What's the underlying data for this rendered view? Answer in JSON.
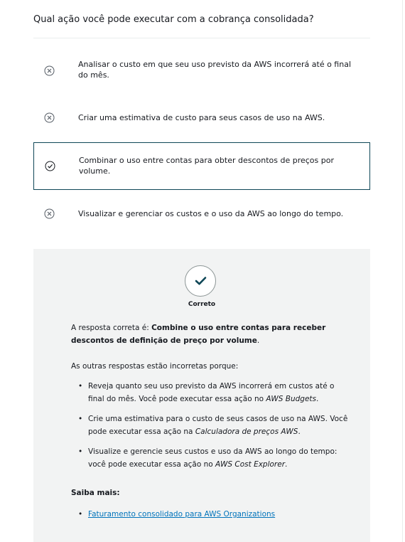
{
  "question": "Qual ação você pode executar com a cobrança consolidada?",
  "options": [
    {
      "text": "Analisar o custo em que seu uso previsto da AWS incorrerá até o final do mês.",
      "state": "incorrect"
    },
    {
      "text": "Criar uma estimativa de custo para seus casos de uso na AWS.",
      "state": "incorrect"
    },
    {
      "text": "Combinar o uso entre contas para obter descontos de preços por volume.",
      "state": "correct"
    },
    {
      "text": "Visualizar e gerenciar os custos e o uso da AWS ao longo do tempo.",
      "state": "incorrect"
    }
  ],
  "feedback": {
    "result_label": "Correto",
    "correct_prefix": "A resposta correta é: ",
    "correct_answer": "Combine o uso entre contas para receber descontos de definição de preço por volume",
    "correct_suffix": ".",
    "others_intro": "As outras respostas estão incorretas porque:",
    "reasons": [
      {
        "text": "Reveja quanto seu uso previsto da AWS incorrerá em custos até o final do mês. Você pode executar essa ação no ",
        "tool": "AWS Budgets",
        "end": "."
      },
      {
        "text": "Crie uma estimativa para o custo de seus casos de uso na AWS. Você pode executar essa ação na ",
        "tool": "Calculadora de preços AWS",
        "end": "."
      },
      {
        "text": "Visualize e gerencie seus custos e uso da AWS ao longo do tempo: você pode executar essa ação no ",
        "tool": "AWS Cost Explorer",
        "end": "."
      }
    ],
    "learn_more_title": "Saiba mais:",
    "links": [
      {
        "label": "Faturamento consolidado para AWS Organizations"
      }
    ]
  },
  "colors": {
    "accent": "#0f4757",
    "link": "#0073bb",
    "panel": "#f2f3f3"
  },
  "icons": {
    "incorrect": "x-circle-icon",
    "correct": "check-circle-icon",
    "result": "checkmark-icon"
  }
}
